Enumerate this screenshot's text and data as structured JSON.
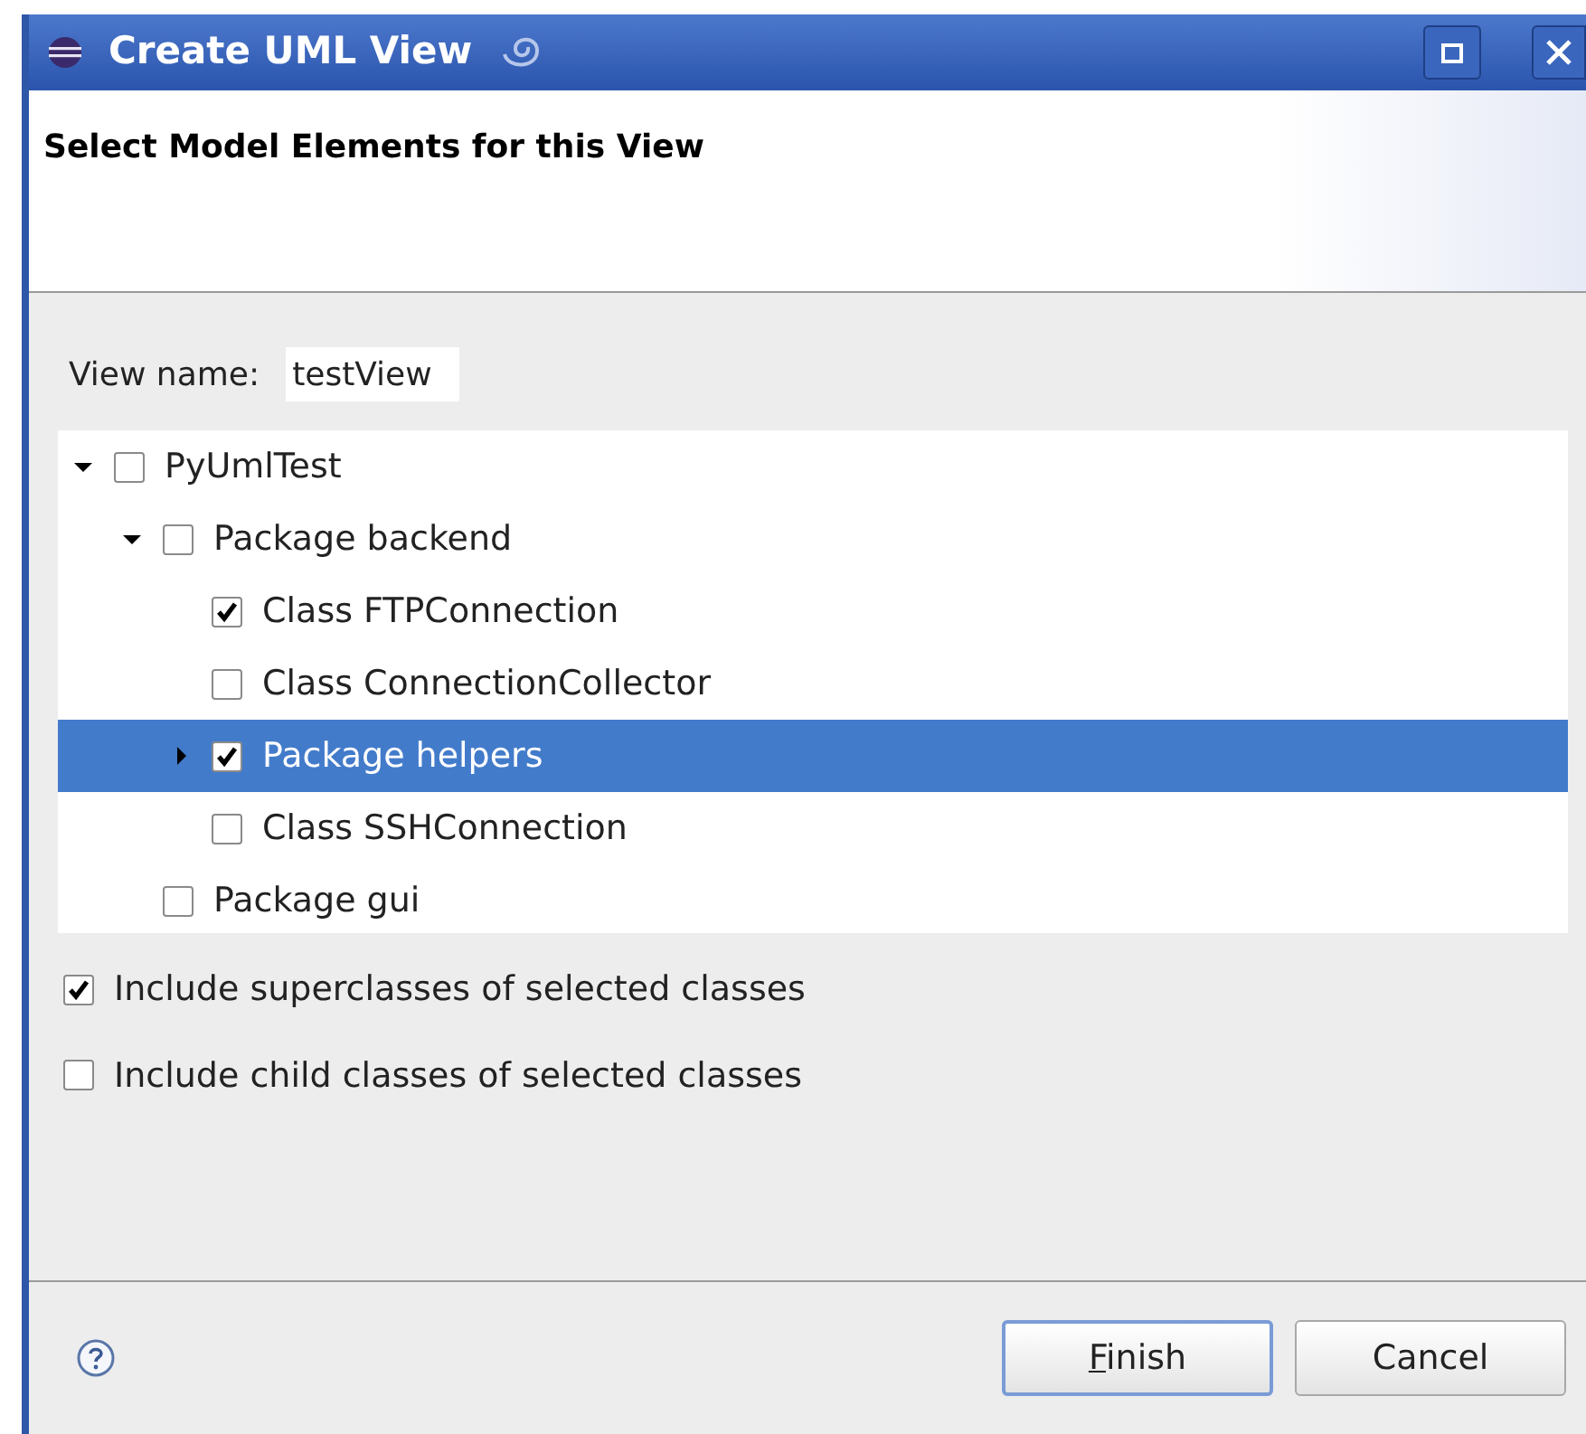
{
  "window": {
    "title": "Create UML View"
  },
  "header": {
    "title": "Select Model Elements for this View"
  },
  "view_name": {
    "label": "View name:",
    "value": "testView"
  },
  "tree": [
    {
      "label": "PyUmlTest",
      "checked": false,
      "expanded": true,
      "selected": false,
      "children": [
        {
          "label": "Package backend",
          "checked": false,
          "expanded": true,
          "selected": false,
          "children": [
            {
              "label": "Class FTPConnection",
              "checked": true,
              "selected": false
            },
            {
              "label": "Class ConnectionCollector",
              "checked": false,
              "selected": false
            },
            {
              "label": "Package helpers",
              "checked": true,
              "expanded": false,
              "has_children": true,
              "selected": true
            },
            {
              "label": "Class SSHConnection",
              "checked": false,
              "selected": false
            }
          ]
        },
        {
          "label": "Package gui",
          "checked": false,
          "selected": false
        }
      ]
    }
  ],
  "options": [
    {
      "label": "Include superclasses of selected classes",
      "checked": true
    },
    {
      "label": "Include child classes of selected classes",
      "checked": false
    }
  ],
  "buttons": [
    {
      "label": "Finish",
      "default": true,
      "underline_first": true
    },
    {
      "label": "Cancel",
      "default": false,
      "underline_first": false
    }
  ]
}
